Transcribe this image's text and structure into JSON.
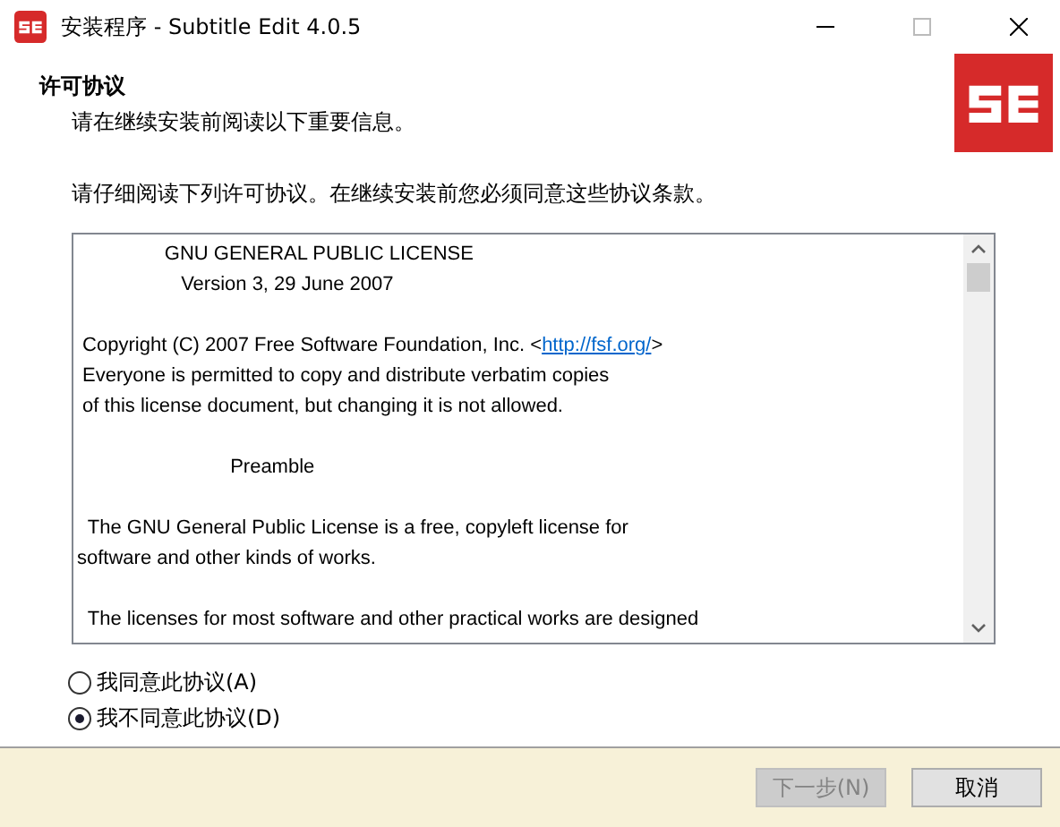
{
  "window": {
    "title": "安装程序 - Subtitle Edit 4.0.5"
  },
  "header": {
    "title": "许可协议",
    "subtitle": "请在继续安装前阅读以下重要信息。"
  },
  "instruction": "请仔细阅读下列许可协议。在继续安装前您必须同意这些协议条款。",
  "license": {
    "lines": [
      {
        "kind": "text",
        "text": "                GNU GENERAL PUBLIC LICENSE"
      },
      {
        "kind": "text",
        "text": "                   Version 3, 29 June 2007"
      },
      {
        "kind": "blank"
      },
      {
        "kind": "link",
        "text": " Copyright (C) 2007 Free Software Foundation, Inc. <",
        "link": "http://fsf.org/",
        "after": ">"
      },
      {
        "kind": "text",
        "text": " Everyone is permitted to copy and distribute verbatim copies"
      },
      {
        "kind": "text",
        "text": " of this license document, but changing it is not allowed."
      },
      {
        "kind": "blank"
      },
      {
        "kind": "text",
        "text": "                            Preamble"
      },
      {
        "kind": "blank"
      },
      {
        "kind": "text",
        "text": "  The GNU General Public License is a free, copyleft license for"
      },
      {
        "kind": "text",
        "text": "software and other kinds of works."
      },
      {
        "kind": "blank"
      },
      {
        "kind": "text",
        "text": "  The licenses for most software and other practical works are designed"
      }
    ]
  },
  "options": [
    {
      "label": "我同意此协议(A)",
      "selected": false
    },
    {
      "label": "我不同意此协议(D)",
      "selected": true
    }
  ],
  "buttons": [
    {
      "label": "下一步(N)",
      "disabled": true
    },
    {
      "label": "取消",
      "disabled": false
    }
  ]
}
